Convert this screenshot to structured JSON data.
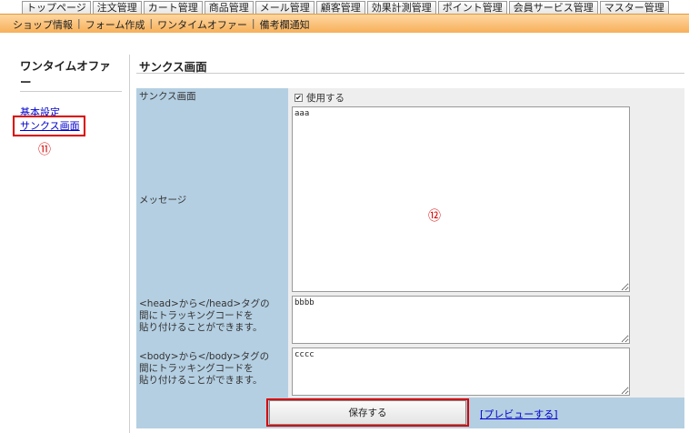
{
  "topnav": {
    "tabs": [
      "トップページ",
      "注文管理",
      "カート管理",
      "商品管理",
      "メール管理",
      "顧客管理",
      "効果計測管理",
      "ポイント管理",
      "会員サービス管理",
      "マスター管理"
    ]
  },
  "subnav": {
    "items": [
      "ショップ情報",
      "フォーム作成",
      "ワンタイムオファー",
      "備考欄通知"
    ],
    "separator": "|"
  },
  "sidebar": {
    "title": "ワンタイムオファー",
    "links": [
      "基本設定",
      "サンクス画面"
    ],
    "marker": "⑪"
  },
  "main": {
    "page_title": "サンクス画面",
    "labels": {
      "thanks_screen": "サンクス画面",
      "message": "メッセージ",
      "head_tracking": "<head>から</head>タグの\n間にトラッキングコードを\n貼り付けることができます。",
      "body_tracking": "<body>から</body>タグの\n間にトラッキングコードを\n貼り付けることができます。"
    },
    "use_checkbox": {
      "label": "使用する",
      "checked": true
    },
    "message_value": "aaa",
    "head_value": "bbbb",
    "body_value": "cccc",
    "marker": "⑫",
    "save_label": "保存する",
    "preview_label": "[プレビューする]"
  },
  "colors": {
    "accent_red": "#d80000",
    "label_bg": "#b4cfe2",
    "subnav_orange": "#f6b05a",
    "link_blue": "#0000cc"
  }
}
